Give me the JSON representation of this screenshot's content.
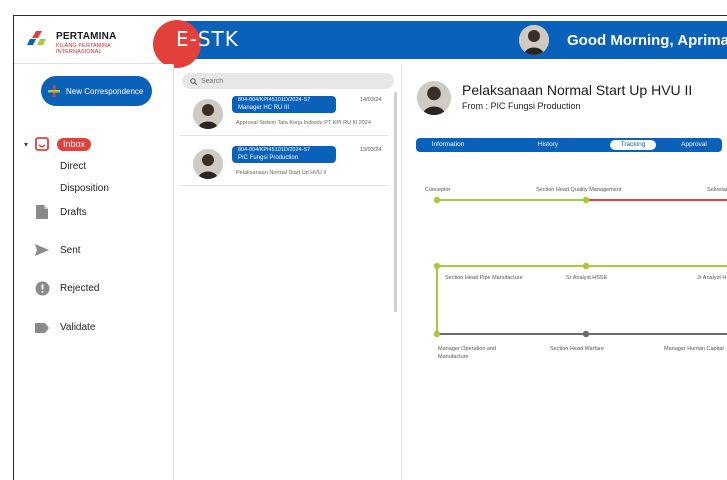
{
  "header": {
    "logo_title": "PERTAMINA",
    "logo_sub1": "KILANG PERTAMINA",
    "logo_sub2": "INTERNASIONAL",
    "app_title": "E-STK",
    "greeting": "Good Morning, Aprimal",
    "brand_blue": "#0a61b9",
    "brand_red": "#e2403b"
  },
  "sidebar": {
    "new_button_label": "New Correspondence",
    "inbox_label": "Inbox",
    "direct_label": "Direct",
    "disposition_label": "Disposition",
    "drafts_label": "Drafts",
    "sent_label": "Sent",
    "rejected_label": "Rejected",
    "validate_label": "Validate"
  },
  "search": {
    "placeholder": "Search"
  },
  "mail_list": [
    {
      "number": "804-004/KPI45101D/2024-S7",
      "recipient": "Manager HC RU III",
      "date": "14/03/24",
      "subject": "Approval Sistem Tata Kerja Individu PT KPI RU III 2024"
    },
    {
      "number": "804-004/KPI45101D/2024-S7",
      "recipient": "PIC Fungsi Production",
      "date": "13/03/24",
      "subject": "Pelaksanaan Normal Start Up HVU II"
    }
  ],
  "detail": {
    "title": "Pelaksanaan Normal Start Up HVU II",
    "from": "From : PIC Fungsi Production",
    "tabs": [
      "Information",
      "History",
      "Tracking",
      "Approval"
    ],
    "active_tab": "Tracking"
  },
  "tracking": {
    "colors": {
      "done": "#a9c93b",
      "rejected": "#e2403b",
      "pending": "#6b6b6b"
    },
    "steps": [
      {
        "label": "Conceptor",
        "status": "done"
      },
      {
        "label": "Section Head Quality Management",
        "status": "done"
      },
      {
        "label": "Sekretaris",
        "status": "rejected"
      },
      {
        "label": "Jr Analyst HSSE",
        "status": "done"
      },
      {
        "label": "Sr Analyst HSSE",
        "status": "done"
      },
      {
        "label": "Section Head Pipe Manufacture",
        "status": "done"
      },
      {
        "label": "Manager Operation and Manufacture",
        "status": "done"
      },
      {
        "label": "Section Head Warfare",
        "status": "pending"
      },
      {
        "label": "Manager Human Capital",
        "status": "pending"
      }
    ]
  }
}
